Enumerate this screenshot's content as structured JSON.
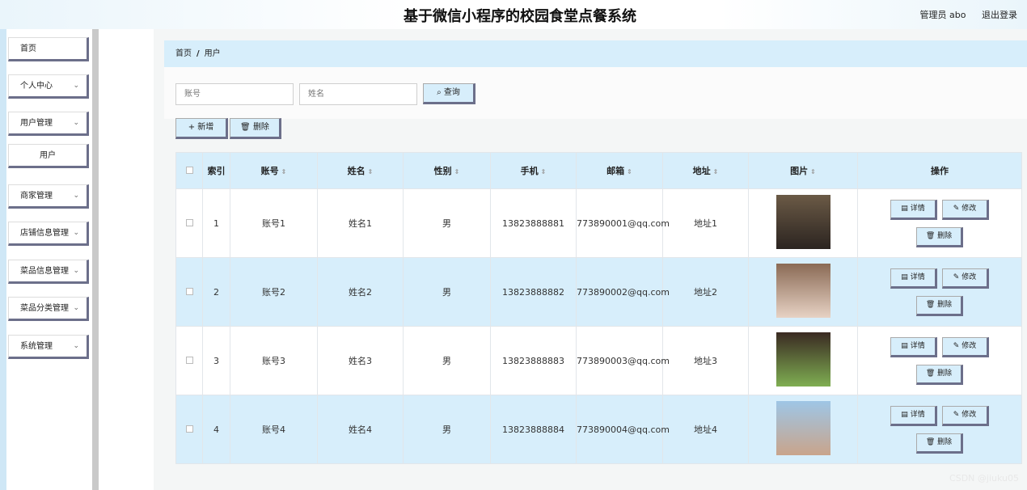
{
  "app": {
    "title": "基于微信小程序的校园食堂点餐系统"
  },
  "header": {
    "user": "管理员 abo",
    "logout": "退出登录"
  },
  "sidebar": {
    "items": [
      {
        "label": "首页",
        "chevron": ""
      },
      {
        "label": "个人中心",
        "chevron": "chevron-down-icon"
      },
      {
        "label": "用户管理",
        "chevron": "chevron-down-icon"
      },
      {
        "label": "用户",
        "chevron": ""
      },
      {
        "label": "商家管理",
        "chevron": "chevron-down-icon"
      },
      {
        "label": "店铺信息管理",
        "chevron": "chevron-down-icon"
      },
      {
        "label": "菜品信息管理",
        "chevron": "chevron-down-icon"
      },
      {
        "label": "菜品分类管理",
        "chevron": "chevron-down-icon"
      },
      {
        "label": "系统管理",
        "chevron": "chevron-down-icon"
      }
    ]
  },
  "breadcrumb": {
    "home": "首页",
    "separator": "/",
    "current": "用户"
  },
  "search": {
    "account_placeholder": "账号",
    "name_placeholder": "姓名",
    "query_label": "查询"
  },
  "actions": {
    "add_label": "新增",
    "delete_label": "删除"
  },
  "table": {
    "headers": [
      "索引",
      "账号",
      "姓名",
      "性别",
      "手机",
      "邮箱",
      "地址",
      "图片",
      "操作"
    ],
    "rows": [
      {
        "index": "1",
        "account": "账号1",
        "name": "姓名1",
        "gender": "男",
        "phone": "13823888881",
        "email": "773890001@qq.com",
        "address": "地址1"
      },
      {
        "index": "2",
        "account": "账号2",
        "name": "姓名2",
        "gender": "男",
        "phone": "13823888882",
        "email": "773890002@qq.com",
        "address": "地址2"
      },
      {
        "index": "3",
        "account": "账号3",
        "name": "姓名3",
        "gender": "男",
        "phone": "13823888883",
        "email": "773890003@qq.com",
        "address": "地址3"
      },
      {
        "index": "4",
        "account": "账号4",
        "name": "姓名4",
        "gender": "男",
        "phone": "13823888884",
        "email": "773890004@qq.com",
        "address": "地址4"
      }
    ],
    "row_ops": {
      "detail": "详情",
      "edit": "修改",
      "delete": "删除"
    }
  },
  "watermark": "CSDN @jiuku05",
  "colors": {
    "accent": "#d7eefb",
    "button_shadow": "#6c6f8a"
  }
}
